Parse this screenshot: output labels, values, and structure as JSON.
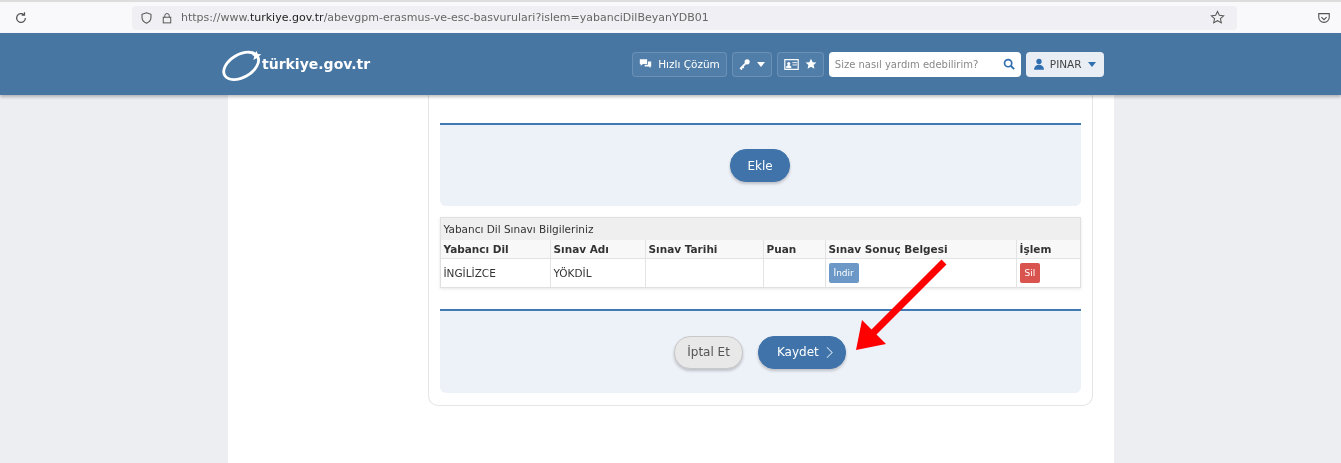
{
  "browser": {
    "url": "https://www.**turkiye.gov.tr**/abevgpm-erasmus-ve-esc-basvurulari?islem=yabanciDilBeyanYDB01"
  },
  "header": {
    "logo": "türkiye.gov.tr",
    "quick_solution": "Hızlı Çözüm",
    "search": {
      "placeholder": "Size nasıl yardım edebilirim?"
    },
    "user": "PINAR"
  },
  "add_button": "Ekle",
  "table": {
    "title": "Yabancı Dil Sınavı Bilgileriniz",
    "columns": [
      "Yabancı Dil",
      "Sınav Adı",
      "Sınav Tarihi",
      "Puan",
      "Sınav Sonuç Belgesi",
      "İşlem"
    ],
    "rows": [
      {
        "language": "İNGİLİZCE",
        "exam": "YÖKDİL",
        "date": "",
        "score": "",
        "download": "İndir",
        "delete": "Sil"
      }
    ]
  },
  "buttons": {
    "cancel": "İptal Et",
    "save": "Kaydet"
  }
}
